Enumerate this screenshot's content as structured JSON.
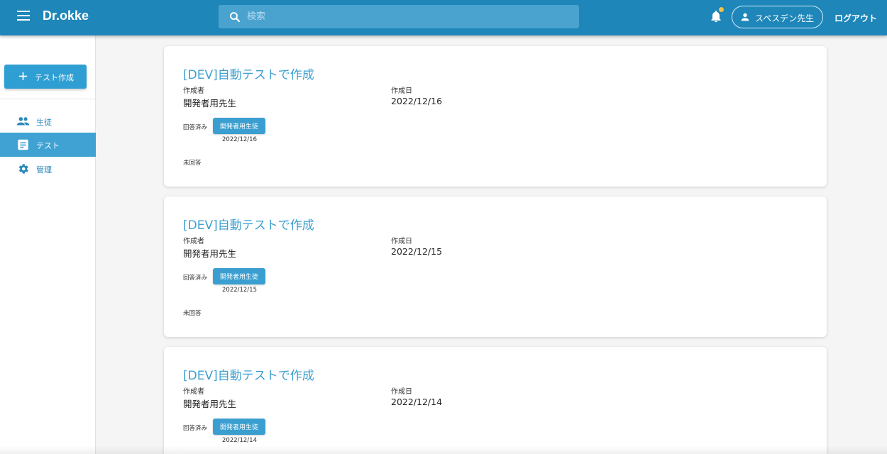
{
  "header": {
    "brand": "Dr.okke",
    "search_placeholder": "検索",
    "user_name": "スペスデン先生",
    "logout_label": "ログアウト",
    "accent_color": "#1e86b9",
    "notification_dot_color": "#f5c242"
  },
  "sidebar": {
    "create_label": "テスト作成",
    "items": [
      {
        "label": "生徒",
        "icon": "people-icon",
        "active": false
      },
      {
        "label": "テスト",
        "icon": "document-icon",
        "active": true
      },
      {
        "label": "管理",
        "icon": "gear-icon",
        "active": false
      }
    ]
  },
  "tests": [
    {
      "title": "[DEV]自動テストで作成",
      "author_label": "作成者",
      "author": "開発者用先生",
      "created_label": "作成日",
      "created": "2022/12/16",
      "answered_label": "回答済み",
      "student": "開発者用生徒",
      "answer_date": "2022/12/16",
      "unanswered_label": "未回答"
    },
    {
      "title": "[DEV]自動テストで作成",
      "author_label": "作成者",
      "author": "開発者用先生",
      "created_label": "作成日",
      "created": "2022/12/15",
      "answered_label": "回答済み",
      "student": "開発者用生徒",
      "answer_date": "2022/12/15",
      "unanswered_label": "未回答"
    },
    {
      "title": "[DEV]自動テストで作成",
      "author_label": "作成者",
      "author": "開発者用先生",
      "created_label": "作成日",
      "created": "2022/12/14",
      "answered_label": "回答済み",
      "student": "開発者用生徒",
      "answer_date": "2022/12/14"
    }
  ]
}
